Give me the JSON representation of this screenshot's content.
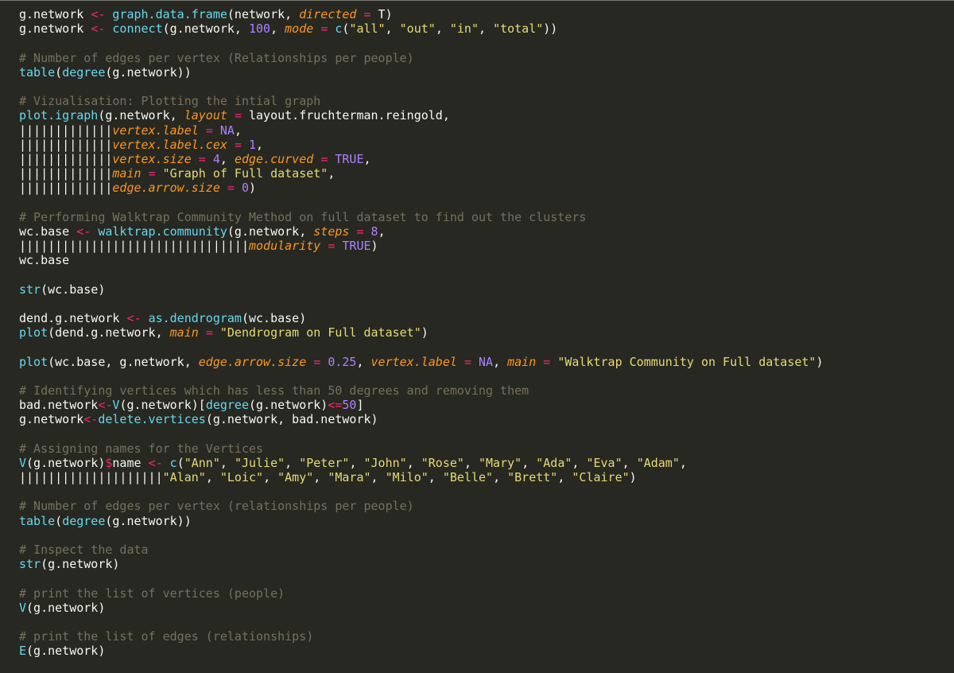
{
  "editor": {
    "language": "R",
    "theme_colors": {
      "background": "#272822",
      "plain": "#f8f8f2",
      "function": "#66d9ef",
      "operator": "#f92672",
      "argument": "#fd971f",
      "number": "#ae81ff",
      "string": "#e6db74",
      "comment": "#75715e",
      "indent_guide": "#4a4b45"
    },
    "lines": [
      [
        [
          "plain",
          "g.network "
        ],
        [
          "op",
          "<-"
        ],
        [
          "plain",
          " "
        ],
        [
          "func",
          "graph.data.frame"
        ],
        [
          "plain",
          "(network, "
        ],
        [
          "arg",
          "directed"
        ],
        [
          "plain",
          " "
        ],
        [
          "op",
          "="
        ],
        [
          "plain",
          " T)"
        ]
      ],
      [
        [
          "plain",
          "g.network "
        ],
        [
          "op",
          "<-"
        ],
        [
          "plain",
          " "
        ],
        [
          "func",
          "connect"
        ],
        [
          "plain",
          "(g.network, "
        ],
        [
          "num",
          "100"
        ],
        [
          "plain",
          ", "
        ],
        [
          "arg",
          "mode"
        ],
        [
          "plain",
          " "
        ],
        [
          "op",
          "="
        ],
        [
          "plain",
          " "
        ],
        [
          "func",
          "c"
        ],
        [
          "plain",
          "("
        ],
        [
          "str",
          "\"all\""
        ],
        [
          "plain",
          ", "
        ],
        [
          "str",
          "\"out\""
        ],
        [
          "plain",
          ", "
        ],
        [
          "str",
          "\"in\""
        ],
        [
          "plain",
          ", "
        ],
        [
          "str",
          "\"total\""
        ],
        [
          "plain",
          "))"
        ]
      ],
      [],
      [
        [
          "cmt",
          "# Number of edges per vertex (Relationships per people)"
        ]
      ],
      [
        [
          "func",
          "table"
        ],
        [
          "plain",
          "("
        ],
        [
          "func",
          "degree"
        ],
        [
          "plain",
          "(g.network))"
        ]
      ],
      [],
      [
        [
          "cmt",
          "# Vizualisation: Plotting the intial graph"
        ]
      ],
      [
        [
          "func",
          "plot.igraph"
        ],
        [
          "plain",
          "(g.network, "
        ],
        [
          "arg",
          "layout"
        ],
        [
          "plain",
          " "
        ],
        [
          "op",
          "="
        ],
        [
          "plain",
          " layout.fruchterman.reingold,"
        ]
      ],
      [
        [
          "guide",
          "|||||||||||||"
        ],
        [
          "arg",
          "vertex.label"
        ],
        [
          "plain",
          " "
        ],
        [
          "op",
          "="
        ],
        [
          "plain",
          " "
        ],
        [
          "num",
          "NA"
        ],
        [
          "plain",
          ","
        ]
      ],
      [
        [
          "guide",
          "|||||||||||||"
        ],
        [
          "arg",
          "vertex.label.cex"
        ],
        [
          "plain",
          " "
        ],
        [
          "op",
          "="
        ],
        [
          "plain",
          " "
        ],
        [
          "num",
          "1"
        ],
        [
          "plain",
          ","
        ]
      ],
      [
        [
          "guide",
          "|||||||||||||"
        ],
        [
          "arg",
          "vertex.size"
        ],
        [
          "plain",
          " "
        ],
        [
          "op",
          "="
        ],
        [
          "plain",
          " "
        ],
        [
          "num",
          "4"
        ],
        [
          "plain",
          ", "
        ],
        [
          "arg",
          "edge.curved"
        ],
        [
          "plain",
          " "
        ],
        [
          "op",
          "="
        ],
        [
          "plain",
          " "
        ],
        [
          "num",
          "TRUE"
        ],
        [
          "plain",
          ","
        ]
      ],
      [
        [
          "guide",
          "|||||||||||||"
        ],
        [
          "arg",
          "main"
        ],
        [
          "plain",
          " "
        ],
        [
          "op",
          "="
        ],
        [
          "plain",
          " "
        ],
        [
          "str",
          "\"Graph of Full dataset\""
        ],
        [
          "plain",
          ","
        ]
      ],
      [
        [
          "guide",
          "|||||||||||||"
        ],
        [
          "arg",
          "edge.arrow.size"
        ],
        [
          "plain",
          " "
        ],
        [
          "op",
          "="
        ],
        [
          "plain",
          " "
        ],
        [
          "num",
          "0"
        ],
        [
          "plain",
          ")"
        ]
      ],
      [],
      [
        [
          "cmt",
          "# Performing Walktrap Community Method on full dataset to find out the clusters"
        ]
      ],
      [
        [
          "plain",
          "wc.base "
        ],
        [
          "op",
          "<-"
        ],
        [
          "plain",
          " "
        ],
        [
          "func",
          "walktrap.community"
        ],
        [
          "plain",
          "(g.network, "
        ],
        [
          "arg",
          "steps"
        ],
        [
          "plain",
          " "
        ],
        [
          "op",
          "="
        ],
        [
          "plain",
          " "
        ],
        [
          "num",
          "8"
        ],
        [
          "plain",
          ","
        ]
      ],
      [
        [
          "guide",
          "||||||||||||||||||||||||||||||||"
        ],
        [
          "arg",
          "modularity"
        ],
        [
          "plain",
          " "
        ],
        [
          "op",
          "="
        ],
        [
          "plain",
          " "
        ],
        [
          "num",
          "TRUE"
        ],
        [
          "plain",
          ")"
        ]
      ],
      [
        [
          "plain",
          "wc.base"
        ]
      ],
      [],
      [
        [
          "func",
          "str"
        ],
        [
          "plain",
          "(wc.base)"
        ]
      ],
      [],
      [
        [
          "plain",
          "dend.g.network "
        ],
        [
          "op",
          "<-"
        ],
        [
          "plain",
          " "
        ],
        [
          "func",
          "as.dendrogram"
        ],
        [
          "plain",
          "(wc.base)"
        ]
      ],
      [
        [
          "func",
          "plot"
        ],
        [
          "plain",
          "(dend.g.network, "
        ],
        [
          "arg",
          "main"
        ],
        [
          "plain",
          " "
        ],
        [
          "op",
          "="
        ],
        [
          "plain",
          " "
        ],
        [
          "str",
          "\"Dendrogram on Full dataset\""
        ],
        [
          "plain",
          ")"
        ]
      ],
      [],
      [
        [
          "func",
          "plot"
        ],
        [
          "plain",
          "(wc.base, g.network, "
        ],
        [
          "arg",
          "edge.arrow.size"
        ],
        [
          "plain",
          " "
        ],
        [
          "op",
          "="
        ],
        [
          "plain",
          " "
        ],
        [
          "num",
          "0.25"
        ],
        [
          "plain",
          ", "
        ],
        [
          "arg",
          "vertex.label"
        ],
        [
          "plain",
          " "
        ],
        [
          "op",
          "="
        ],
        [
          "plain",
          " "
        ],
        [
          "num",
          "NA"
        ],
        [
          "plain",
          ", "
        ],
        [
          "arg",
          "main"
        ],
        [
          "plain",
          " "
        ],
        [
          "op",
          "="
        ],
        [
          "plain",
          " "
        ],
        [
          "str",
          "\"Walktrap Community on Full dataset\""
        ],
        [
          "plain",
          ")"
        ]
      ],
      [],
      [
        [
          "cmt",
          "# Identifying vertices which has less than 50 degrees and removing them"
        ]
      ],
      [
        [
          "plain",
          "bad.network"
        ],
        [
          "op",
          "<-"
        ],
        [
          "func",
          "V"
        ],
        [
          "plain",
          "(g.network)["
        ],
        [
          "func",
          "degree"
        ],
        [
          "plain",
          "(g.network)"
        ],
        [
          "op",
          "<="
        ],
        [
          "num",
          "50"
        ],
        [
          "plain",
          "]"
        ]
      ],
      [
        [
          "plain",
          "g.network"
        ],
        [
          "op",
          "<-"
        ],
        [
          "func",
          "delete.vertices"
        ],
        [
          "plain",
          "(g.network, bad.network)"
        ]
      ],
      [],
      [
        [
          "cmt",
          "# Assigning names for the Vertices"
        ]
      ],
      [
        [
          "func",
          "V"
        ],
        [
          "plain",
          "(g.network)"
        ],
        [
          "op",
          "$"
        ],
        [
          "plain",
          "name "
        ],
        [
          "op",
          "<-"
        ],
        [
          "plain",
          " "
        ],
        [
          "func",
          "c"
        ],
        [
          "plain",
          "("
        ],
        [
          "str",
          "\"Ann\""
        ],
        [
          "plain",
          ", "
        ],
        [
          "str",
          "\"Julie\""
        ],
        [
          "plain",
          ", "
        ],
        [
          "str",
          "\"Peter\""
        ],
        [
          "plain",
          ", "
        ],
        [
          "str",
          "\"John\""
        ],
        [
          "plain",
          ", "
        ],
        [
          "str",
          "\"Rose\""
        ],
        [
          "plain",
          ", "
        ],
        [
          "str",
          "\"Mary\""
        ],
        [
          "plain",
          ", "
        ],
        [
          "str",
          "\"Ada\""
        ],
        [
          "plain",
          ", "
        ],
        [
          "str",
          "\"Eva\""
        ],
        [
          "plain",
          ", "
        ],
        [
          "str",
          "\"Adam\""
        ],
        [
          "plain",
          ","
        ]
      ],
      [
        [
          "guide",
          "||||||||||||||||||||"
        ],
        [
          "str",
          "\"Alan\""
        ],
        [
          "plain",
          ", "
        ],
        [
          "str",
          "\"Loic\""
        ],
        [
          "plain",
          ", "
        ],
        [
          "str",
          "\"Amy\""
        ],
        [
          "plain",
          ", "
        ],
        [
          "str",
          "\"Mara\""
        ],
        [
          "plain",
          ", "
        ],
        [
          "str",
          "\"Milo\""
        ],
        [
          "plain",
          ", "
        ],
        [
          "str",
          "\"Belle\""
        ],
        [
          "plain",
          ", "
        ],
        [
          "str",
          "\"Brett\""
        ],
        [
          "plain",
          ", "
        ],
        [
          "str",
          "\"Claire\""
        ],
        [
          "plain",
          ")"
        ]
      ],
      [],
      [
        [
          "cmt",
          "# Number of edges per vertex (relationships per people)"
        ]
      ],
      [
        [
          "func",
          "table"
        ],
        [
          "plain",
          "("
        ],
        [
          "func",
          "degree"
        ],
        [
          "plain",
          "(g.network))"
        ]
      ],
      [],
      [
        [
          "cmt",
          "# Inspect the data"
        ]
      ],
      [
        [
          "func",
          "str"
        ],
        [
          "plain",
          "(g.network)"
        ]
      ],
      [],
      [
        [
          "cmt",
          "# print the list of vertices (people)"
        ]
      ],
      [
        [
          "func",
          "V"
        ],
        [
          "plain",
          "(g.network)"
        ]
      ],
      [],
      [
        [
          "cmt",
          "# print the list of edges (relationships)"
        ]
      ],
      [
        [
          "func",
          "E"
        ],
        [
          "plain",
          "(g.network)"
        ]
      ]
    ]
  }
}
